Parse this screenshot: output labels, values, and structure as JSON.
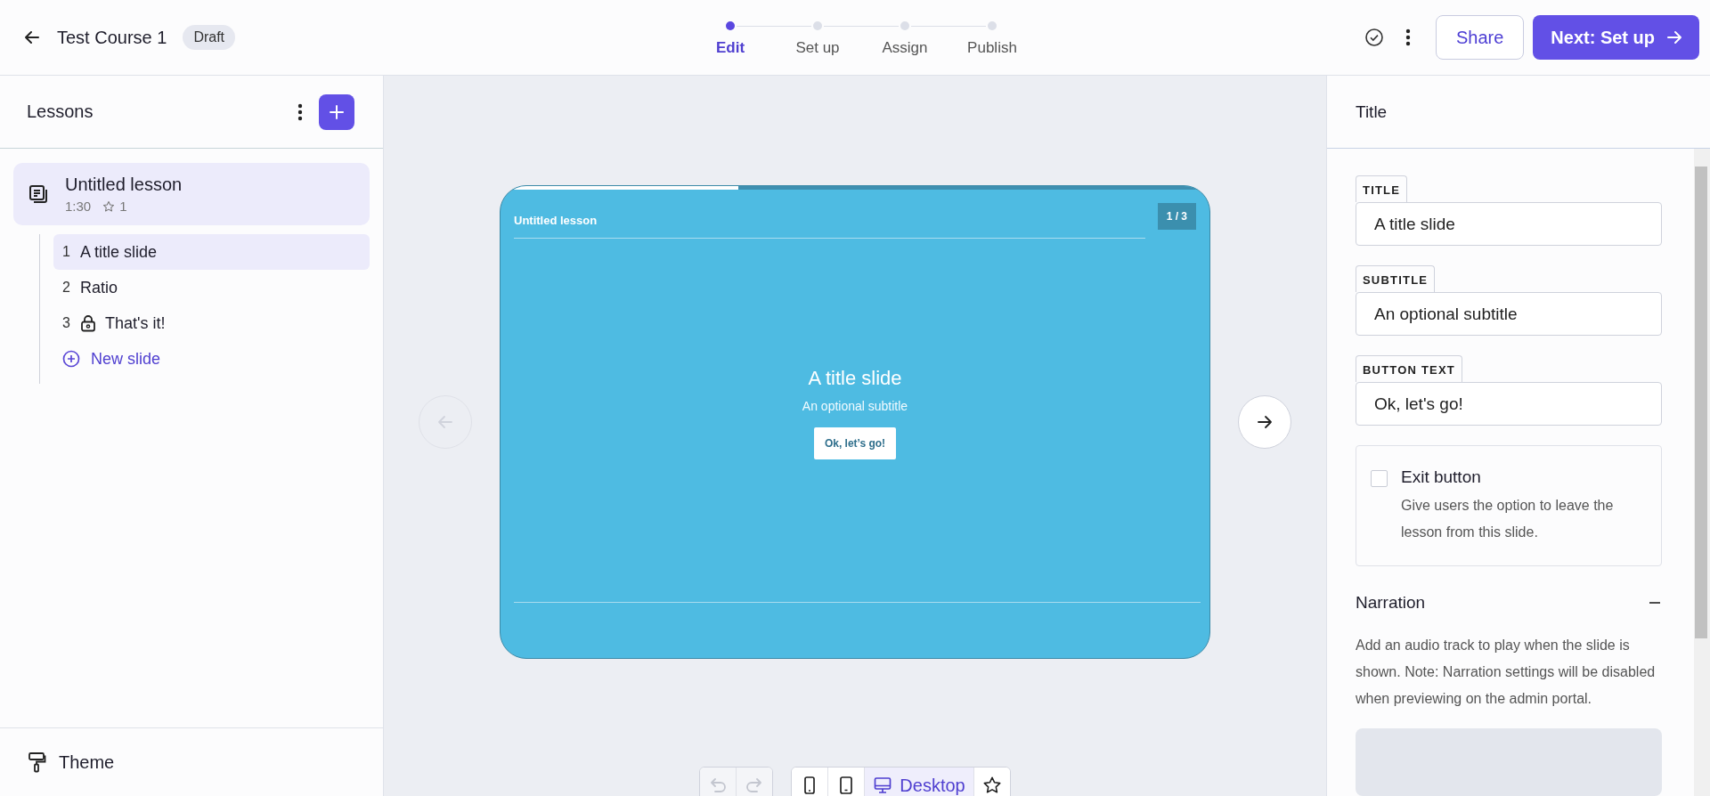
{
  "header": {
    "title": "Test Course 1",
    "status": "Draft"
  },
  "steps": [
    {
      "label": "Edit",
      "selected": true
    },
    {
      "label": "Set up",
      "selected": false
    },
    {
      "label": "Assign",
      "selected": false
    },
    {
      "label": "Publish",
      "selected": false
    }
  ],
  "actions": {
    "share": "Share",
    "next": "Next: Set up"
  },
  "sidebar": {
    "title": "Lessons",
    "lesson": {
      "title": "Untitled lesson",
      "duration": "1:30",
      "stars_count": "1",
      "selected": true
    },
    "slides": [
      {
        "number": "1",
        "title": "A title slide",
        "selected": true,
        "locked": false
      },
      {
        "number": "2",
        "title": "Ratio",
        "selected": false,
        "locked": false
      },
      {
        "number": "3",
        "title": "That's it!",
        "selected": false,
        "locked": true
      }
    ],
    "new_slide": "New slide",
    "theme": "Theme"
  },
  "preview": {
    "lesson_title": "Untitled lesson",
    "counter": "1 / 3",
    "level": 0.335,
    "title": "A title slide",
    "subtitle": "An optional subtitle",
    "button": "Ok, let’s go!",
    "prev_disabled": true,
    "next_disabled": false
  },
  "toolbar": {
    "undo_disabled": true,
    "redo_disabled": true,
    "devices": [
      {
        "kind": "phone",
        "selected": false
      },
      {
        "kind": "tablet",
        "selected": false
      },
      {
        "kind": "desktop",
        "label": "Desktop",
        "selected": true
      },
      {
        "kind": "star",
        "selected": false
      }
    ]
  },
  "panel": {
    "title": "Title",
    "fields": [
      {
        "label": "TITLE",
        "value": "A title slide"
      },
      {
        "label": "SUBTITLE",
        "value": "An optional subtitle"
      },
      {
        "label": "BUTTON TEXT",
        "value": "Ok, let's go!"
      }
    ],
    "exit": {
      "label": "Exit button",
      "description": "Give users the option to leave the lesson from this slide.",
      "checked": false
    },
    "narration": {
      "title": "Narration",
      "expanded": true,
      "description": "Add an audio track to play when the slide is shown. Note: Narration settings will be disabled when previewing on the admin portal."
    }
  }
}
